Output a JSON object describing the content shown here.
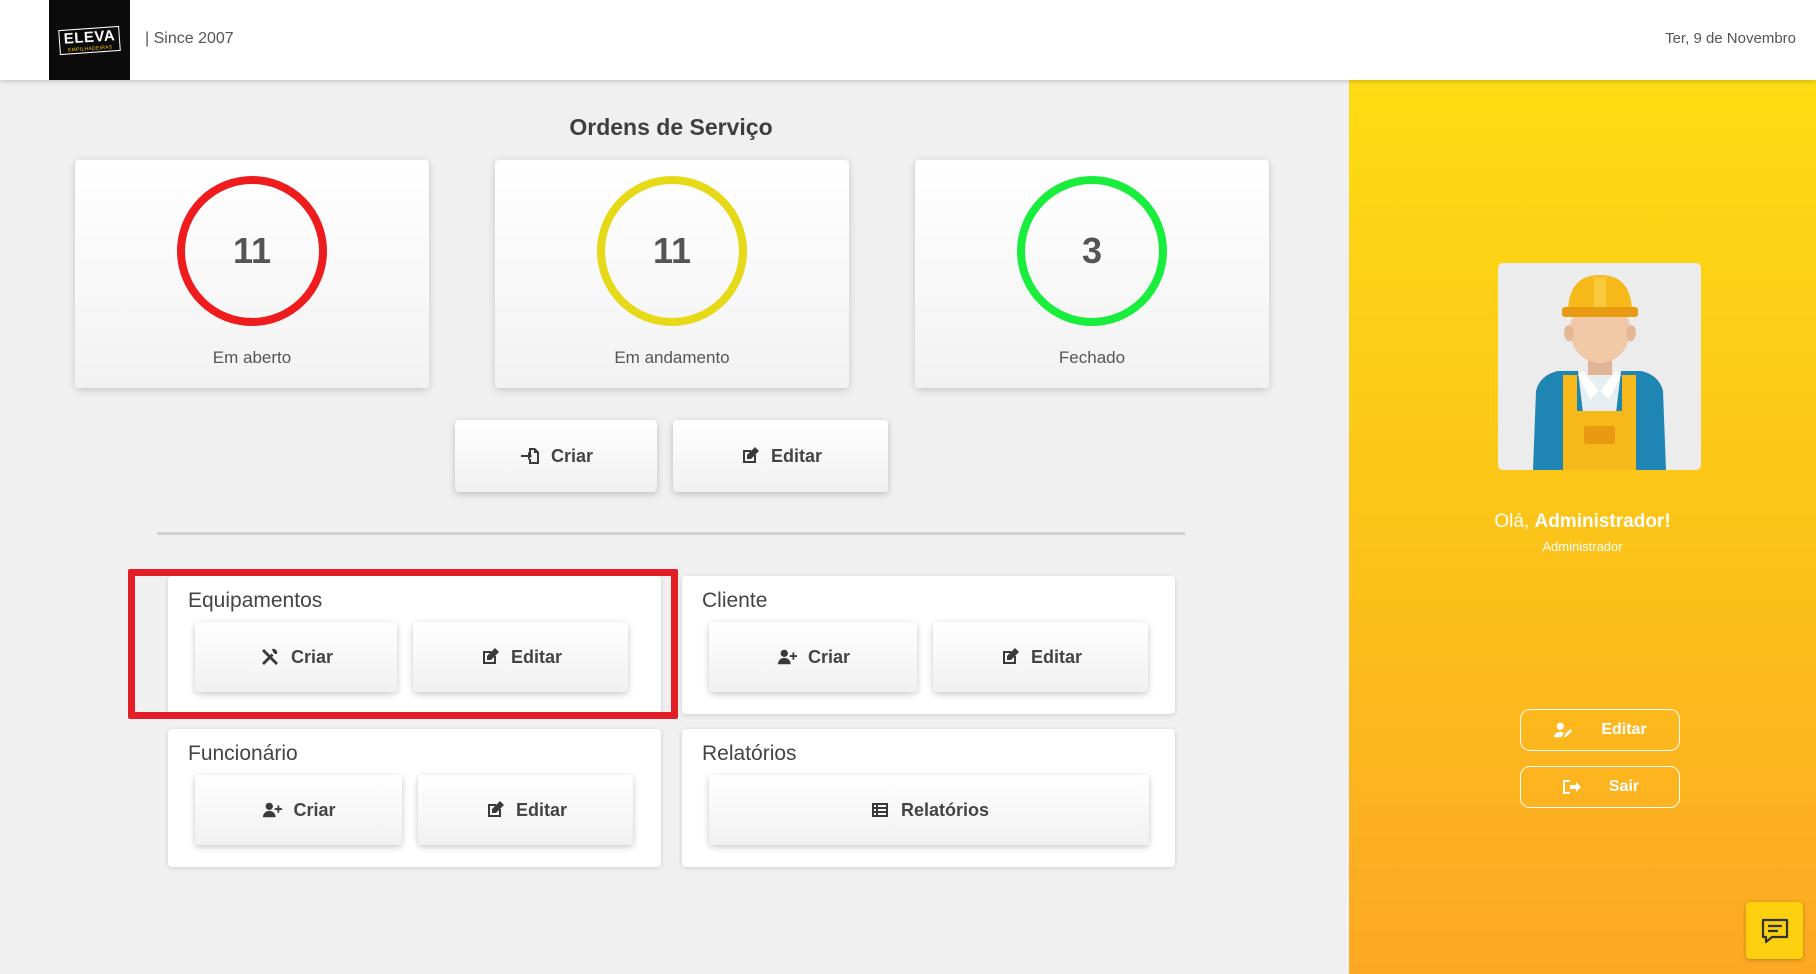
{
  "header": {
    "logo_text": "ELEVA",
    "logo_subtext": "EMPILHADEIRAS",
    "since": "| Since 2007",
    "date": "Ter, 9 de Novembro"
  },
  "orders": {
    "title": "Ordens de Serviço",
    "stats": [
      {
        "value": "11",
        "label": "Em aberto",
        "color": "#ee1c1c"
      },
      {
        "value": "11",
        "label": "Em andamento",
        "color": "#e6d917"
      },
      {
        "value": "3",
        "label": "Fechado",
        "color": "#19ee3c"
      }
    ],
    "create_label": "Criar",
    "edit_label": "Editar"
  },
  "sections": {
    "equipamentos": {
      "title": "Equipamentos",
      "create_label": "Criar",
      "edit_label": "Editar"
    },
    "cliente": {
      "title": "Cliente",
      "create_label": "Criar",
      "edit_label": "Editar"
    },
    "funcionario": {
      "title": "Funcionário",
      "create_label": "Criar",
      "edit_label": "Editar"
    },
    "relatorios": {
      "title": "Relatórios",
      "button_label": "Relatórios"
    }
  },
  "sidebar": {
    "greeting_prefix": "Olá, ",
    "greeting_name": "Administrador!",
    "role": "Administrador",
    "edit_label": "Editar",
    "logout_label": "Sair"
  },
  "colors": {
    "sidebar_gradient_top": "#fddc13",
    "sidebar_gradient_bottom": "#fca824",
    "highlight": "#e41e26"
  },
  "icons": [
    "file-import-icon",
    "edit-icon",
    "tools-icon",
    "user-plus-icon",
    "list-icon",
    "user-edit-icon",
    "sign-out-icon",
    "chat-icon"
  ]
}
